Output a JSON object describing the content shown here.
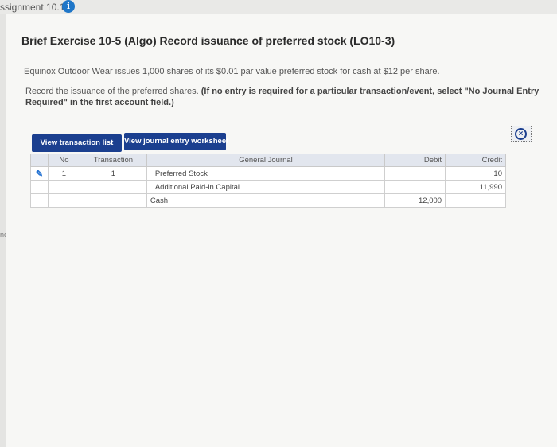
{
  "assignment": {
    "title": "ssignment 10.1"
  },
  "side": {
    "label": "nces"
  },
  "exercise": {
    "title": "Brief Exercise 10-5 (Algo) Record issuance of preferred stock (LO10-3)",
    "problem": "Equinox Outdoor Wear issues 1,000 shares of its $0.01 par value preferred stock for cash at $12 per share.",
    "instruction_plain": "Record the issuance of the preferred shares.",
    "instruction_bold": "(If no entry is required for a particular transaction/event, select \"No Journal Entry Required\" in the first account field.)"
  },
  "buttons": {
    "view_transaction_list": "View transaction list",
    "view_journal_worksheet": "View journal entry worksheet"
  },
  "journal": {
    "headers": {
      "no": "No",
      "transaction": "Transaction",
      "general_journal": "General Journal",
      "debit": "Debit",
      "credit": "Credit"
    },
    "rows": [
      {
        "no": "1",
        "transaction": "1",
        "account": "Preferred Stock",
        "debit": "",
        "credit": "10"
      },
      {
        "no": "",
        "transaction": "",
        "account": "Additional Paid-in Capital",
        "debit": "",
        "credit": "11,990"
      },
      {
        "no": "",
        "transaction": "",
        "account": "Cash",
        "debit": "12,000",
        "credit": ""
      }
    ]
  },
  "colors": {
    "button": "#1b3f8f",
    "info": "#1f76c8"
  }
}
